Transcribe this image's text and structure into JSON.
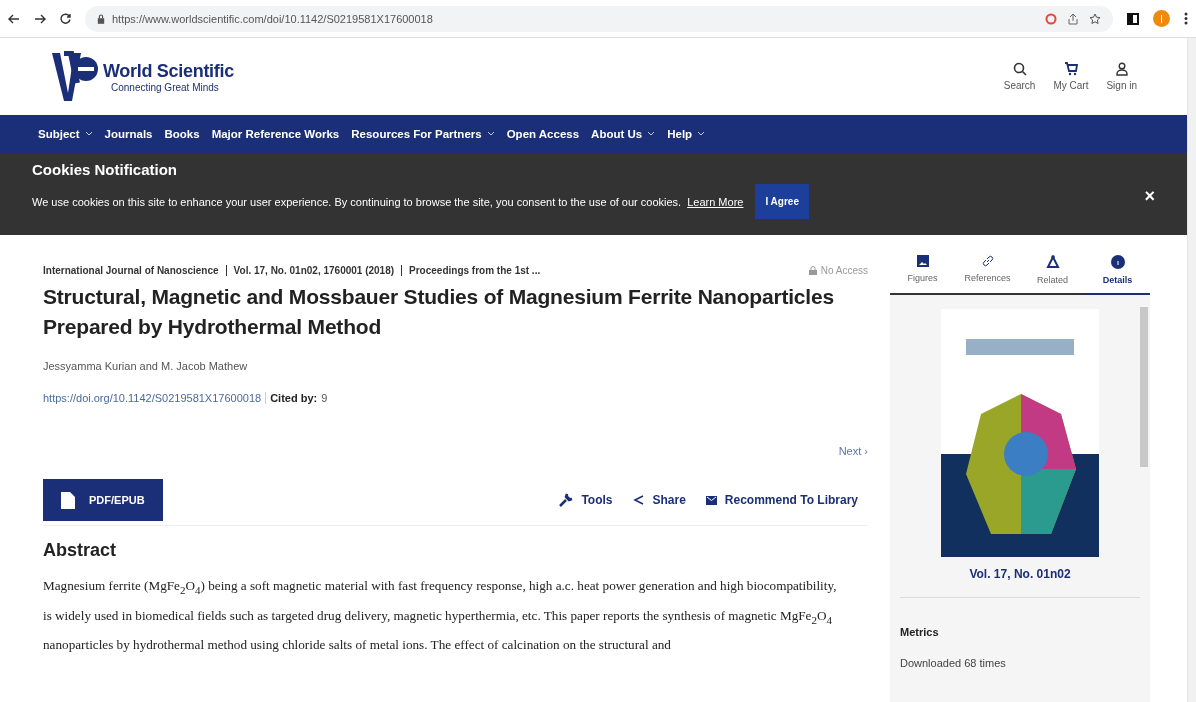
{
  "browser": {
    "url": "https://www.worldscientific.com/doi/10.1142/S0219581X17600018",
    "profile_initial": "I"
  },
  "header": {
    "logo_name": "World Scientific",
    "logo_tagline": "Connecting Great Minds",
    "actions": [
      {
        "kind": "search",
        "label": "Search"
      },
      {
        "kind": "cart",
        "label": "My Cart"
      },
      {
        "kind": "user",
        "label": "Sign in"
      }
    ]
  },
  "nav": [
    {
      "label": "Subject",
      "dropdown": true
    },
    {
      "label": "Journals",
      "dropdown": false
    },
    {
      "label": "Books",
      "dropdown": false
    },
    {
      "label": "Major Reference Works",
      "dropdown": false
    },
    {
      "label": "Resources For Partners",
      "dropdown": true
    },
    {
      "label": "Open Access",
      "dropdown": false
    },
    {
      "label": "About Us",
      "dropdown": true
    },
    {
      "label": "Help",
      "dropdown": true
    }
  ],
  "cookies": {
    "title": "Cookies Notification",
    "message": "We use cookies on this site to enhance your user experience. By continuing to browse the site, you consent to the use of our cookies.",
    "link": "Learn More",
    "button": "I Agree",
    "close": "×"
  },
  "article": {
    "breadcrumb": [
      "International Journal of Nanoscience",
      "Vol. 17, No. 01n02, 1760001 (2018)",
      "Proceedings from the 1st ..."
    ],
    "access": "No Access",
    "title": "Structural, Magnetic and Mossbauer Studies of Magnesium Ferrite Nanoparticles Prepared by Hydrothermal Method",
    "authors": "Jessyamma Kurian and M. Jacob Mathew",
    "doi": "https://doi.org/10.1142/S0219581X17600018",
    "cited_label": "Cited by:",
    "cited_count": "9",
    "next": "Next ›",
    "pdf_button": "PDF/EPUB",
    "tools": [
      {
        "kind": "tools",
        "label": "Tools"
      },
      {
        "kind": "share",
        "label": "Share"
      },
      {
        "kind": "mail",
        "label": "Recommend To Library"
      }
    ],
    "abstract_heading": "Abstract",
    "abstract": "Magnesium ferrite (MgFe$_{2}$O$_{4}$) being a soft magnetic material with fast frequency response, high a.c. heat power generation and high biocompatibility, is widely used in biomedical fields such as targeted drug delivery, magnetic hyperthermia, etc. This paper reports the synthesis of magnetic MgFe$_{2}$O$_{4}$ nanoparticles by hydrothermal method using chloride salts of metal ions. The effect of calcination on the structural and"
  },
  "sidebar": {
    "tabs": [
      {
        "kind": "figures",
        "label": "Figures",
        "selected": false
      },
      {
        "kind": "references",
        "label": "References",
        "selected": false
      },
      {
        "kind": "related",
        "label": "Related",
        "selected": false
      },
      {
        "kind": "details",
        "label": "Details",
        "selected": true
      }
    ],
    "issue": "Vol. 17, No. 01n02",
    "metrics_heading": "Metrics",
    "downloads": "Downloaded 68 times"
  }
}
